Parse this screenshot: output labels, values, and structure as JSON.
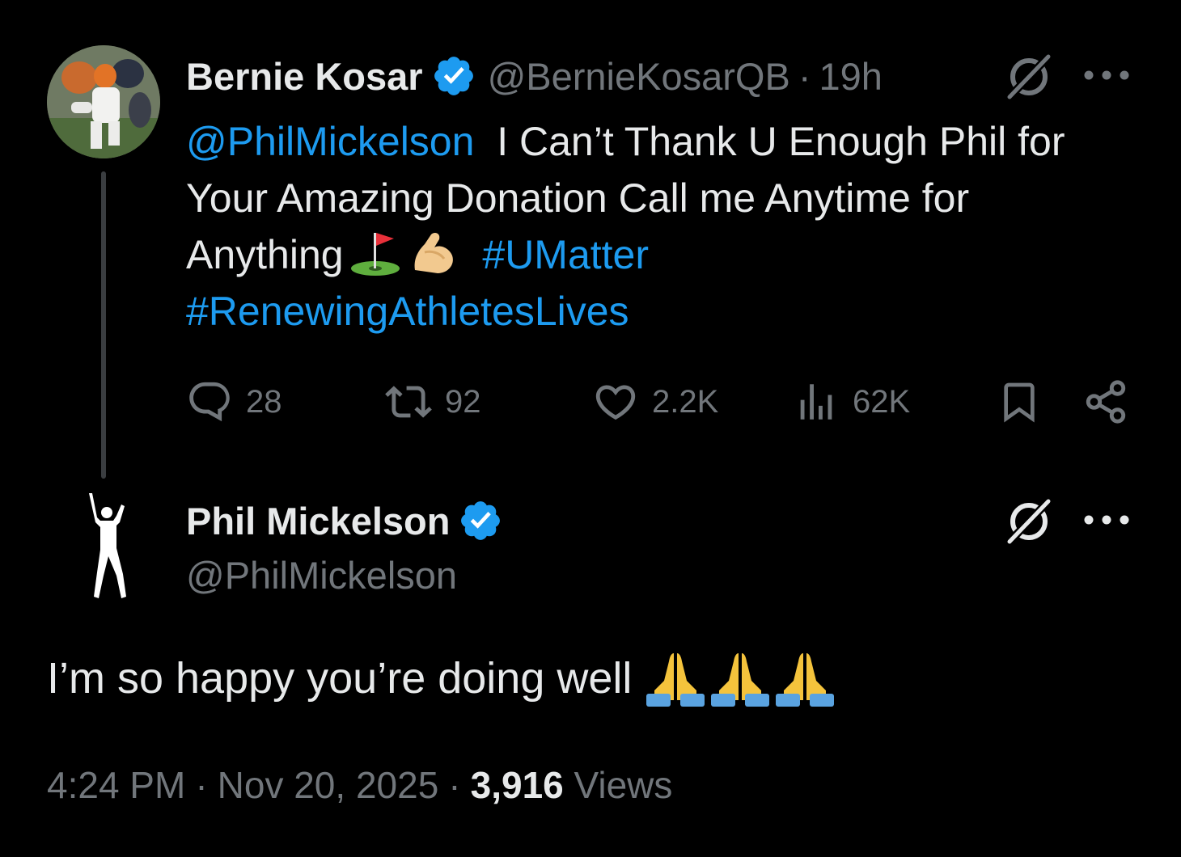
{
  "tweet": {
    "author": {
      "name": "Bernie Kosar",
      "handle": "@BernieKosarQB",
      "verified": true,
      "avatar_icon": "football-player-avatar"
    },
    "time_ago": "19h",
    "text": {
      "mention": "@PhilMickelson",
      "line1": "I Can’t Thank U Enough Phil for",
      "line2": "Your Amazing Donation Call me Anytime for",
      "line3": "Anything",
      "hashtag1": "#UMatter",
      "hashtag2": "#RenewingAthletesLives",
      "emojis": [
        "golf-flag-emoji",
        "flexed-biceps-emoji"
      ]
    },
    "stats": {
      "replies": "28",
      "reposts": "92",
      "likes": "2.2K",
      "views": "62K"
    }
  },
  "reply": {
    "author": {
      "name": "Phil Mickelson",
      "handle": "@PhilMickelson",
      "verified": true,
      "avatar_icon": "golfer-silhouette-avatar"
    },
    "text": "I’m so happy you’re doing well",
    "emojis": [
      "folded-hands-emoji",
      "folded-hands-emoji",
      "folded-hands-emoji"
    ],
    "time": "4:24 PM",
    "date": "Nov 20, 2025",
    "views_count": "3,916",
    "views_label": "Views"
  },
  "colors": {
    "background": "#000000",
    "text_primary": "#e7e9ea",
    "text_secondary": "#71767b",
    "link": "#1d9bf0",
    "verified": "#1d9bf0"
  }
}
